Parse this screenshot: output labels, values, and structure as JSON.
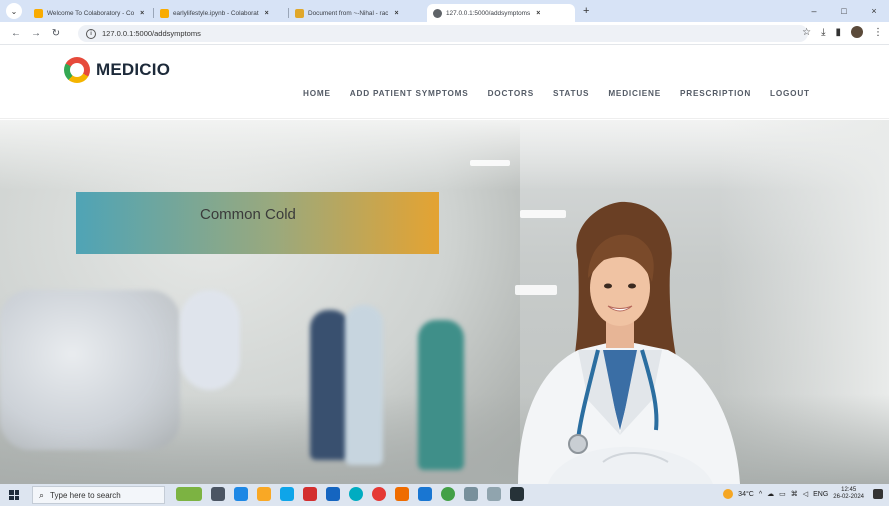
{
  "browser": {
    "tabs": [
      {
        "title": "Welcome To Colaboratory - Co",
        "favicon_color": "#f9ab00",
        "active": false
      },
      {
        "title": "earlylifestyle.ipynb - Colaborat",
        "favicon_color": "#f9ab00",
        "active": false
      },
      {
        "title": "Document from ~-Nihal - rac",
        "favicon_color": "#e0a72a",
        "active": false
      },
      {
        "title": "127.0.0.1:5000/addsymptoms",
        "favicon_color": "#5f6368",
        "active": true
      }
    ],
    "tab_close_glyph": "×",
    "new_tab_glyph": "+",
    "window_controls": [
      "–",
      "□",
      "×"
    ],
    "url": "127.0.0.1:5000/addsymptoms"
  },
  "site": {
    "logo_text": "MEDICIO",
    "menu": [
      "HOME",
      "ADD PATIENT SYMPTOMS",
      "DOCTORS",
      "STATUS",
      "MEDICIENE",
      "PRESCRIPTION",
      "LOGOUT"
    ]
  },
  "hero": {
    "banner_text": "Common Cold",
    "banner_colors": [
      "#4fa4b6",
      "#e4a332"
    ]
  },
  "taskbar": {
    "search_placeholder": "Type here to search",
    "temperature": "34°C",
    "language": "ENG",
    "time": "12:45",
    "date": "26-02-2024"
  }
}
